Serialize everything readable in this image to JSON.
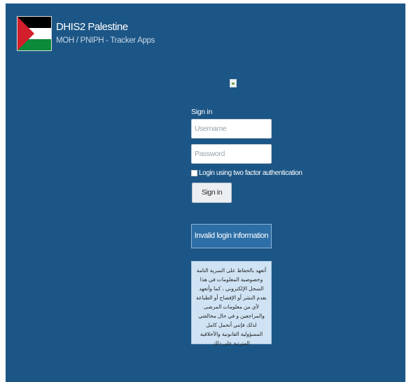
{
  "brand": {
    "title": "DHIS2 Palestine",
    "subtitle": "MOH / PNIPH - Tracker Apps",
    "flag_icon": "palestine-flag"
  },
  "login": {
    "signin_label": "Sign in",
    "username_placeholder": "Username",
    "password_placeholder": "Password",
    "two_factor_label": "Login using two factor authentication",
    "signin_button": "Sign in",
    "error_message": "Invalid login information",
    "notice_text": "أتعهد بالحفاظ على السرية التامة وخصوصية المعلومات في هذا السجل الإلكتروني ، كما وأتعهد بعدم النشر أو الإفصاح أو الطباعة لأي من معلومات المرضى والمراجعين و في حال مخالفتي لذلك فإنني أتحمل كامل المسؤولية القانونية والأخلاقية المترتبة على ذلك"
  },
  "colors": {
    "background": "#1c5686",
    "alert": "#2d6ea6",
    "notice": "#cfe3f4"
  }
}
